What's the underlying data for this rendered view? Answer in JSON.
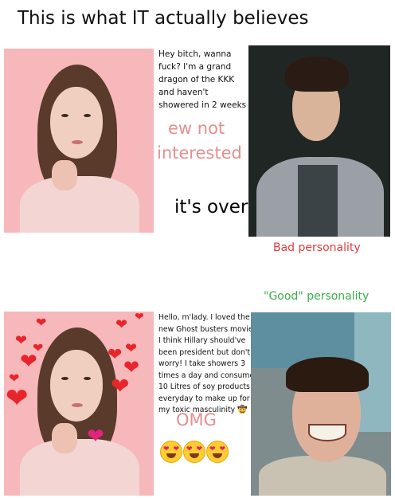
{
  "title": "This is what IT actually believes",
  "top": {
    "message": [
      "Hey bitch, wanna",
      "fuck? I'm a grand",
      "dragon of the KKK",
      "and haven't",
      "showered in 2 weeks"
    ],
    "reply": [
      "ew not",
      "interested"
    ],
    "verdict": "it's over",
    "label": "Bad personality"
  },
  "bottom": {
    "label": "\"Good\" personality",
    "message": [
      "Hello, m'lady. I loved the",
      "new Ghost busters movie!",
      "I think Hillary should've",
      "been president but don't",
      "worry! I take showers 3",
      "times a day and consume",
      "10 Litres of soy products",
      "everyday to make up for",
      "my toxic masculinity"
    ],
    "reply": "OMG"
  },
  "colors": {
    "pink_panel": "#f6b8bb",
    "reply_pink": "#e58f8f",
    "bad_label": "#e23a3a",
    "good_label": "#3cae4a",
    "heart": "#e8252b"
  },
  "icons": [
    "heart-icon",
    "cowboy-emoji-icon",
    "heart-eyes-emoji-icon",
    "cupid-heart-icon"
  ]
}
